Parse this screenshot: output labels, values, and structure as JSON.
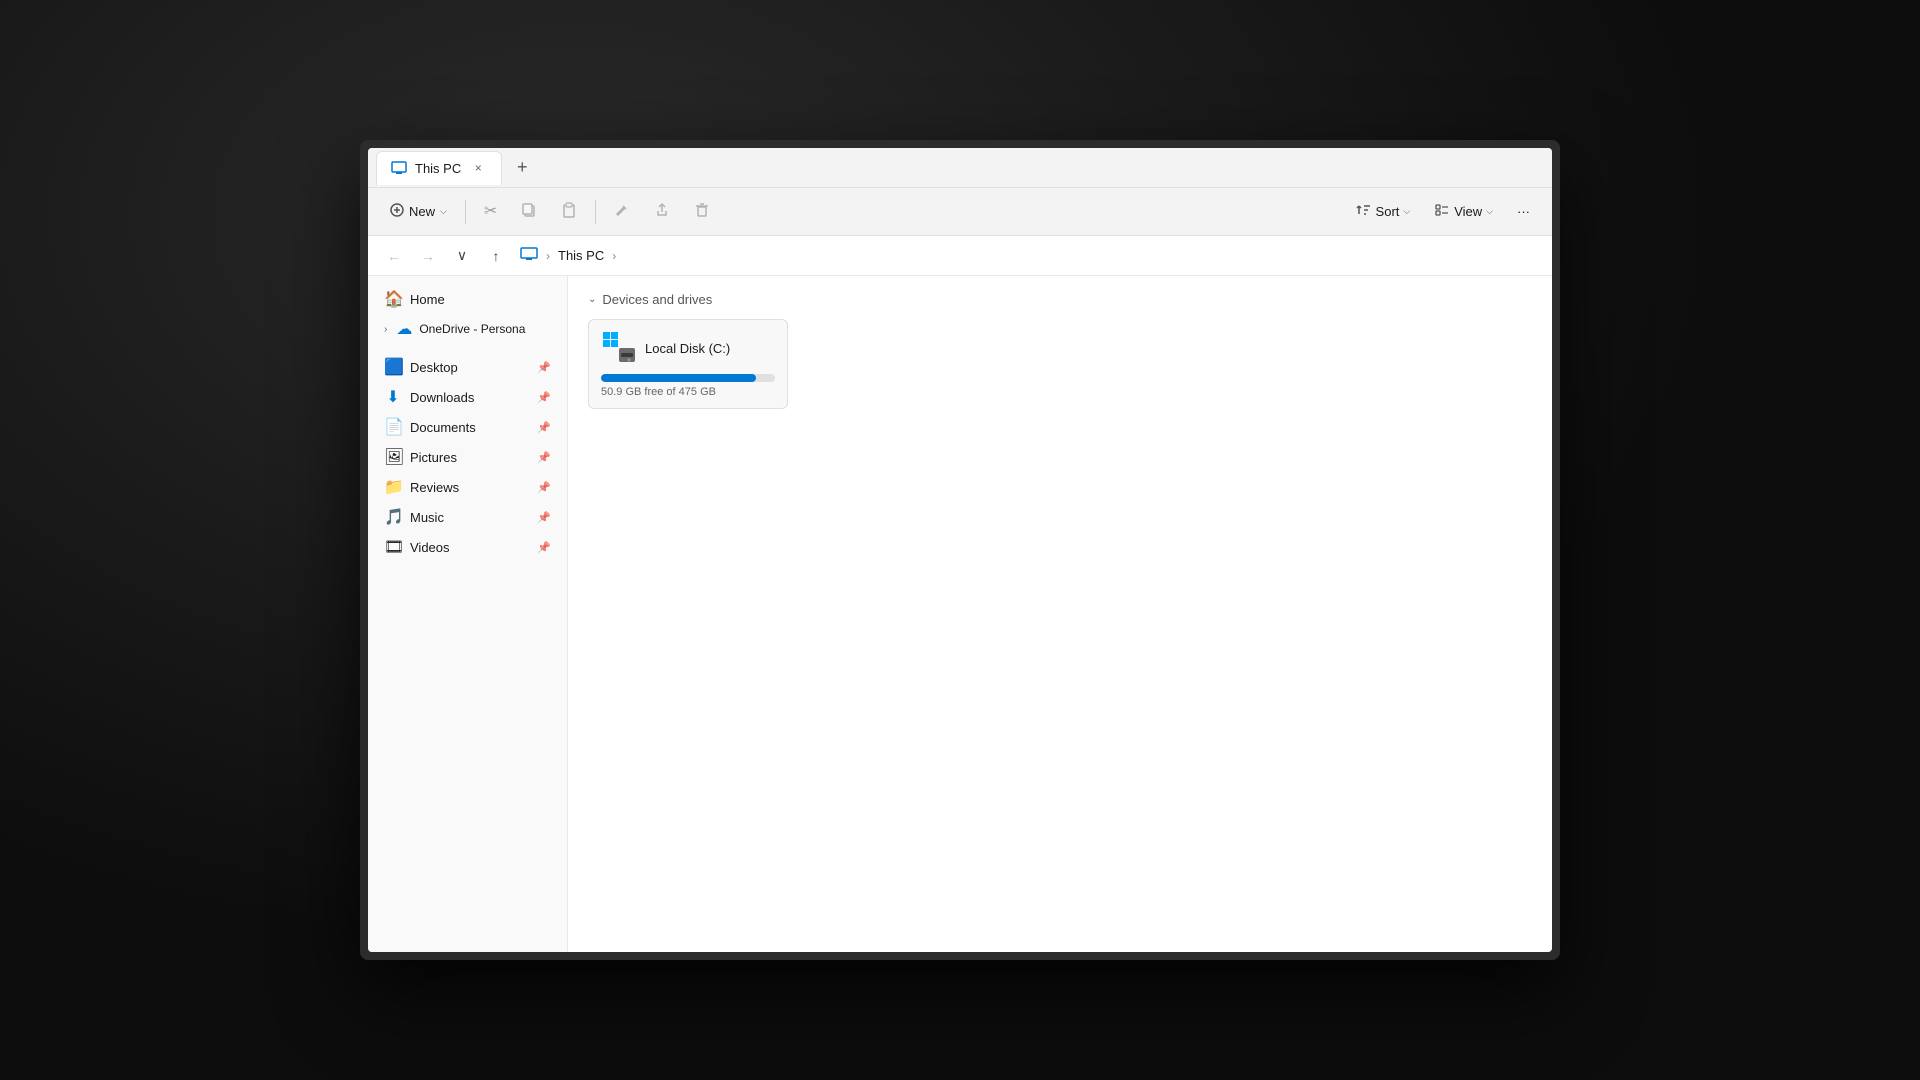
{
  "window": {
    "title": "This PC",
    "tab_close_label": "×",
    "tab_new_label": "+"
  },
  "toolbar": {
    "new_label": "New",
    "sort_label": "Sort",
    "view_label": "View",
    "more_label": "···"
  },
  "nav": {
    "breadcrumb_pc_icon": "💻",
    "breadcrumb_this_pc": "This PC",
    "breadcrumb_sep1": ">",
    "breadcrumb_sep2": ">"
  },
  "sidebar": {
    "home_label": "Home",
    "onedrive_label": "OneDrive - Persona",
    "items": [
      {
        "label": "Desktop",
        "icon": "🟦",
        "pinned": true
      },
      {
        "label": "Downloads",
        "icon": "⬇️",
        "pinned": true
      },
      {
        "label": "Documents",
        "icon": "📄",
        "pinned": true
      },
      {
        "label": "Pictures",
        "icon": "🖼️",
        "pinned": true
      },
      {
        "label": "Reviews",
        "icon": "📁",
        "pinned": true
      },
      {
        "label": "Music",
        "icon": "🎵",
        "pinned": true
      },
      {
        "label": "Videos",
        "icon": "🎞️",
        "pinned": true
      }
    ]
  },
  "content": {
    "section_label": "Devices and drives",
    "drives": [
      {
        "name": "Local Disk (C:)",
        "free": "50.9 GB free of 475 GB",
        "used_pct": 89
      }
    ]
  },
  "icons": {
    "back": "←",
    "forward": "→",
    "dropdown": "∨",
    "up": "↑",
    "scissors": "✂",
    "copy": "⧉",
    "paste": "📋",
    "rename": "✏️",
    "share": "↗",
    "delete": "🗑",
    "sort_arrow": "⇅",
    "view_lines": "≡",
    "chevron_down": "⌵",
    "collapse": "⌄",
    "pin": "📌",
    "home": "🏠",
    "expand": "›"
  }
}
